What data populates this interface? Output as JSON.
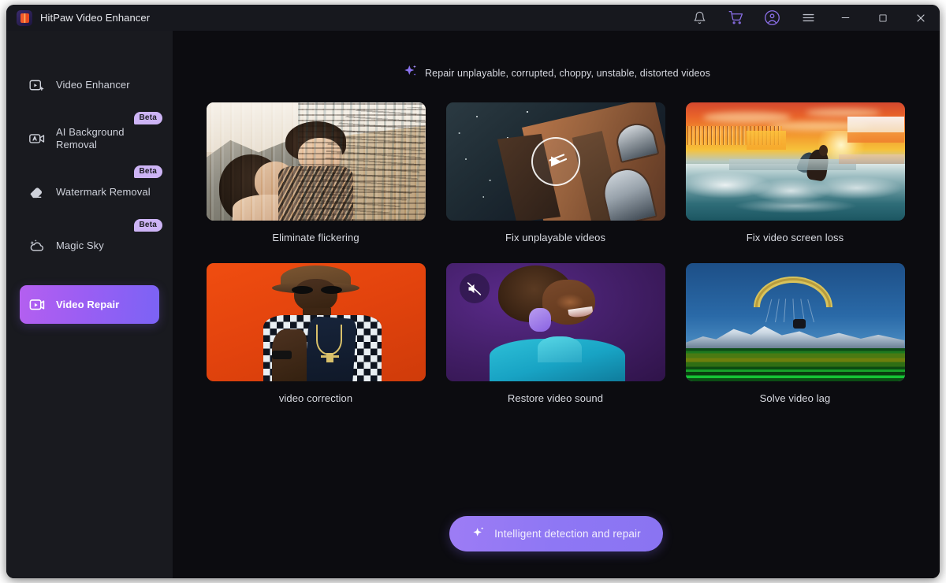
{
  "window": {
    "title": "HitPaw Video Enhancer",
    "logo_icon": "hitpaw-logo-icon"
  },
  "titlebar": {
    "actions": [
      {
        "name": "notification-bell-icon",
        "label": "Notifications"
      },
      {
        "name": "shopping-cart-icon",
        "label": "Store"
      },
      {
        "name": "user-account-icon",
        "label": "Account"
      },
      {
        "name": "hamburger-menu-icon",
        "label": "Menu"
      }
    ],
    "window_controls": [
      {
        "name": "minimize-button",
        "label": "Minimize"
      },
      {
        "name": "maximize-button",
        "label": "Maximize"
      },
      {
        "name": "close-button",
        "label": "Close"
      }
    ]
  },
  "sidebar": {
    "items": [
      {
        "label": "Video Enhancer",
        "icon": "video-enhance-icon",
        "badge": "",
        "active": false
      },
      {
        "label": "AI Background Removal",
        "icon": "ai-camera-icon",
        "badge": "Beta",
        "active": false
      },
      {
        "label": "Watermark Removal",
        "icon": "eraser-icon",
        "badge": "Beta",
        "active": false
      },
      {
        "label": "Magic Sky",
        "icon": "cloud-sparkle-icon",
        "badge": "Beta",
        "active": false
      },
      {
        "label": "Video Repair",
        "icon": "video-repair-icon",
        "badge": "",
        "active": true
      }
    ]
  },
  "main": {
    "hint": {
      "icon": "sparkle-icon",
      "text": "Repair unplayable, corrupted, choppy, unstable, distorted videos"
    },
    "cards": [
      {
        "label": "Eliminate flickering",
        "art": "art-flicker",
        "overlay": ""
      },
      {
        "label": "Fix unplayable videos",
        "art": "art-night",
        "overlay": "play-icon"
      },
      {
        "label": "Fix video screen loss",
        "art": "art-surf",
        "overlay": ""
      },
      {
        "label": "video correction",
        "art": "art-orange",
        "overlay": ""
      },
      {
        "label": "Restore video sound",
        "art": "art-purple",
        "overlay": "mute-icon"
      },
      {
        "label": "Solve video lag",
        "art": "art-glide",
        "overlay": ""
      }
    ],
    "cta": {
      "label": "Intelligent detection and repair",
      "icon": "sparkle-icon"
    }
  },
  "colors": {
    "accent_purple": "#8e77f4",
    "accent_magenta": "#b45ff0",
    "badge_bg": "#cdb4f5",
    "sidebar_bg": "#191a1f",
    "main_bg": "#0c0c10",
    "titlebar_bg": "#17181e"
  }
}
